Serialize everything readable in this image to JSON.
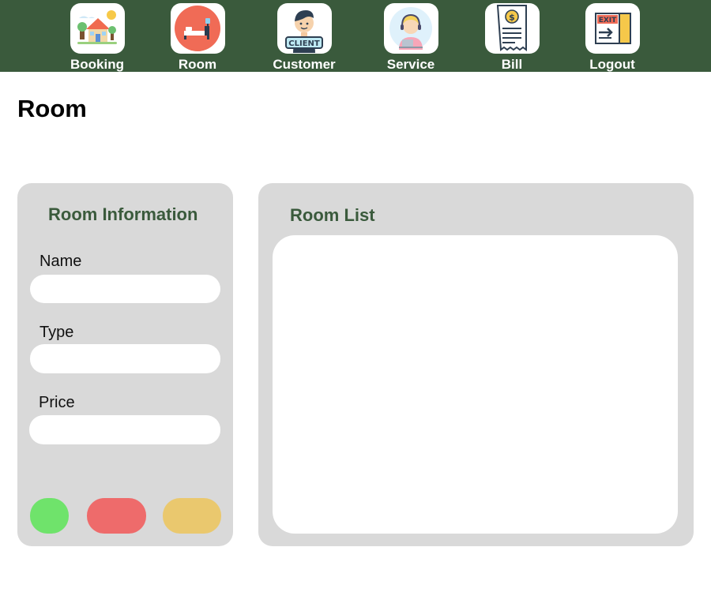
{
  "nav": {
    "items": [
      {
        "label": "Booking",
        "icon": "house-icon"
      },
      {
        "label": "Room",
        "icon": "bed-icon"
      },
      {
        "label": "Customer",
        "icon": "client-icon"
      },
      {
        "label": "Service",
        "icon": "support-agent-icon"
      },
      {
        "label": "Bill",
        "icon": "receipt-icon"
      },
      {
        "label": "Logout",
        "icon": "exit-icon"
      }
    ]
  },
  "page": {
    "title": "Room"
  },
  "form": {
    "title": "Room Information",
    "fields": [
      {
        "label": "Name",
        "value": "",
        "placeholder": ""
      },
      {
        "label": "Type",
        "value": "",
        "placeholder": ""
      },
      {
        "label": "Price",
        "value": "",
        "placeholder": ""
      }
    ],
    "buttons": [
      {
        "color": "#6fe36b"
      },
      {
        "color": "#ee6b6b"
      },
      {
        "color": "#eac86e"
      }
    ]
  },
  "list": {
    "title": "Room List"
  },
  "colors": {
    "nav_background": "#3a5a3c",
    "panel_background": "#d9d9d9",
    "heading_green": "#3a5a3c"
  }
}
